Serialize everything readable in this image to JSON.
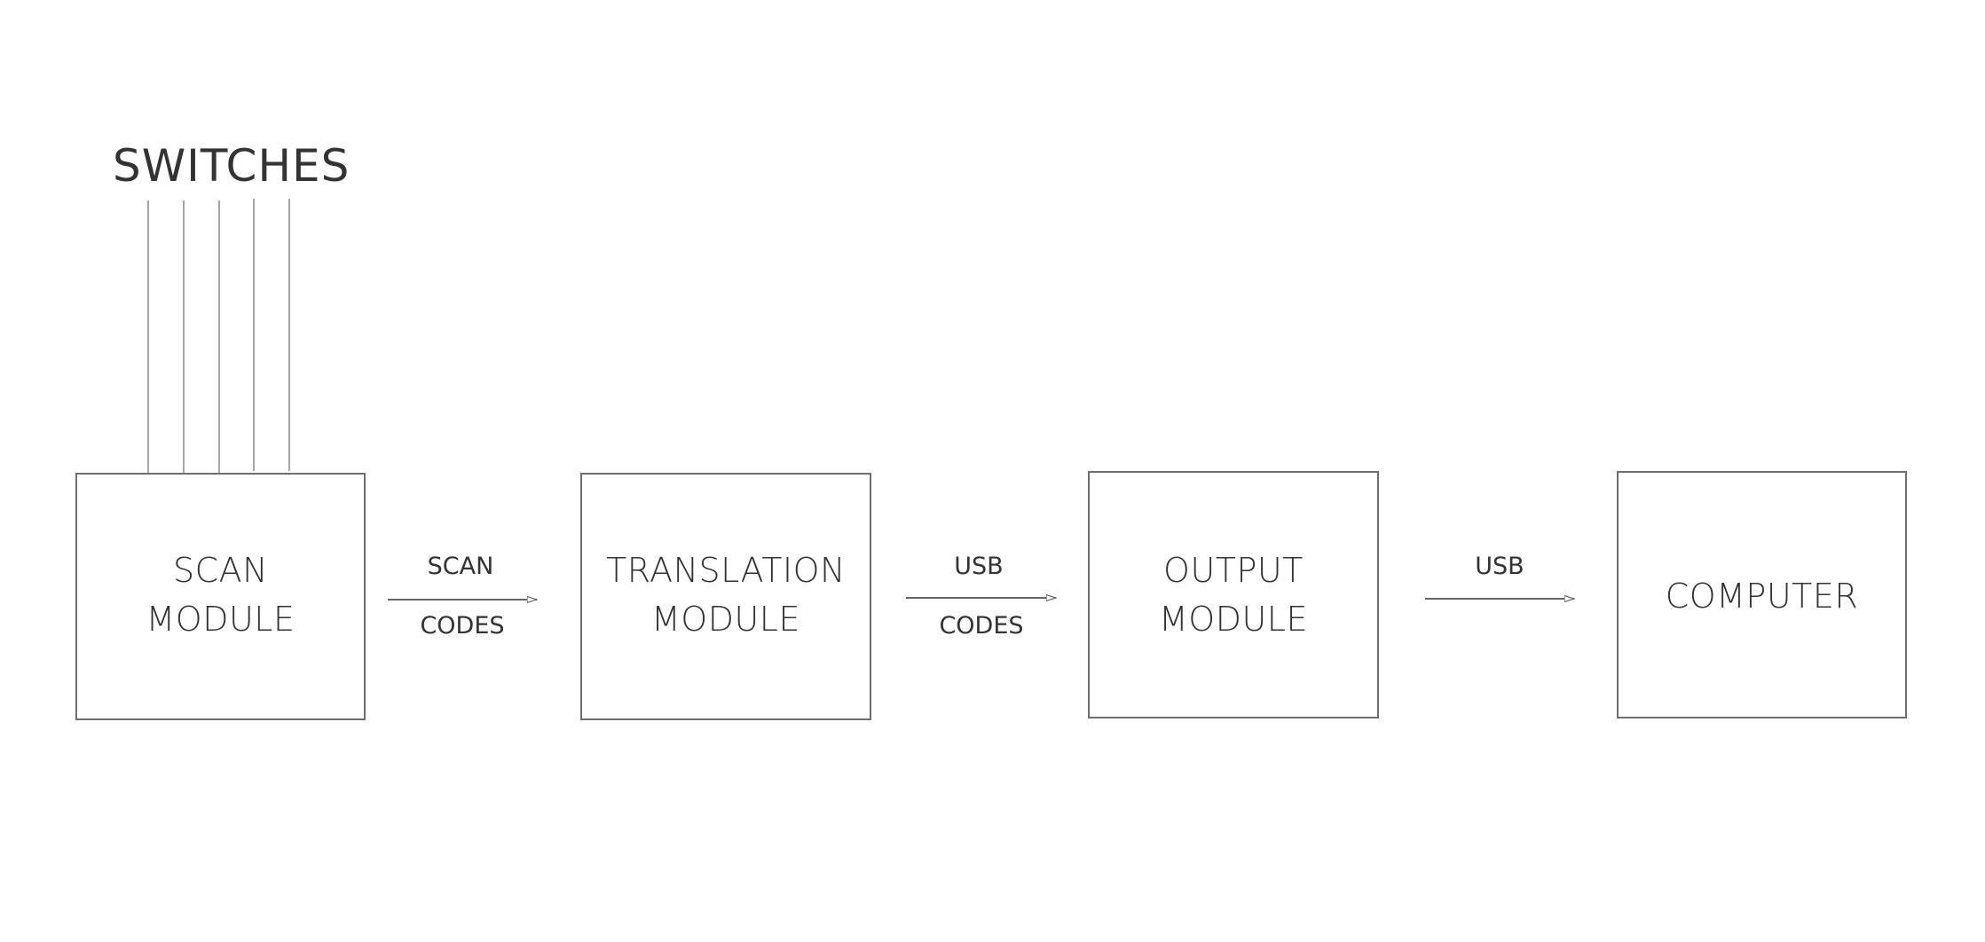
{
  "diagram": {
    "title": "SWITCHES",
    "switch_line_count": 5,
    "colors": {
      "text": "#333333",
      "box_border": "#6e6e6e",
      "wire": "#a6a6a6",
      "arrow": "#666666"
    },
    "nodes": [
      {
        "id": "scan",
        "lines": [
          "SCAN",
          "MODULE"
        ]
      },
      {
        "id": "translation",
        "lines": [
          "TRANSLATION",
          "MODULE"
        ]
      },
      {
        "id": "output",
        "lines": [
          "OUTPUT",
          "MODULE"
        ]
      },
      {
        "id": "computer",
        "lines": [
          "COMPUTER"
        ]
      }
    ],
    "edges": [
      {
        "from": "scan",
        "to": "translation",
        "label_top": "SCAN",
        "label_bottom": "CODES"
      },
      {
        "from": "translation",
        "to": "output",
        "label_top": "USB",
        "label_bottom": "CODES"
      },
      {
        "from": "output",
        "to": "computer",
        "label_top": "USB",
        "label_bottom": ""
      }
    ]
  }
}
